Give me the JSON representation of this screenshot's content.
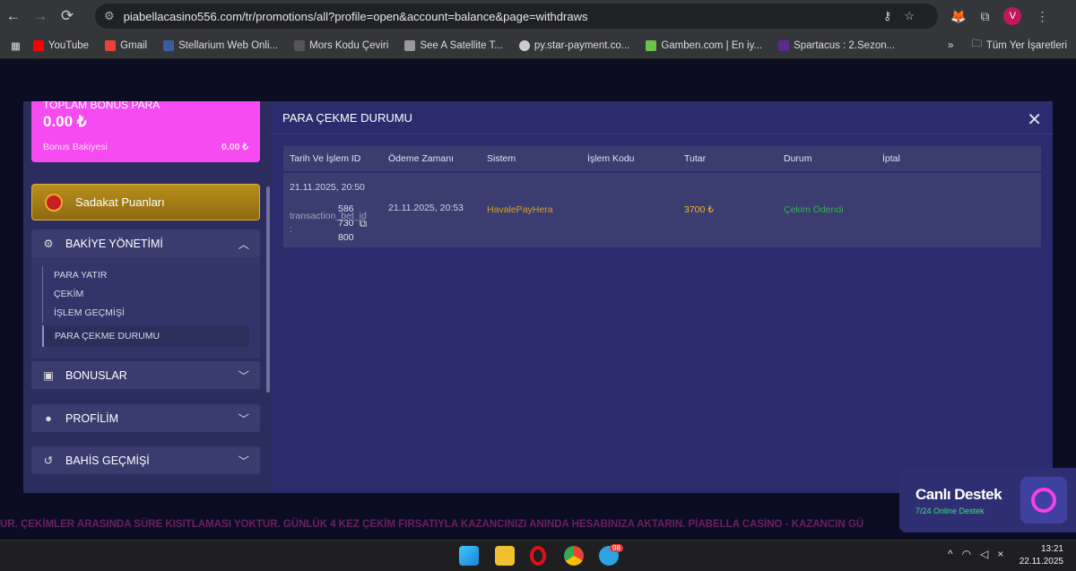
{
  "browser": {
    "url": "piabellacasino556.com/tr/promotions/all?profile=open&account=balance&page=withdraws",
    "profile_initial": "V",
    "bookmarks": [
      {
        "label": "YouTube",
        "color": "#ff0000"
      },
      {
        "label": "Gmail",
        "color": "#ea4335"
      },
      {
        "label": "Stellarium Web Onli...",
        "color": "#3a5fa0"
      },
      {
        "label": "Mors Kodu Çeviri",
        "color": "#555"
      },
      {
        "label": "See A Satellite T...",
        "color": "#999"
      },
      {
        "label": "py.star-payment.co...",
        "color": "#ccc"
      },
      {
        "label": "Gamben.com | En iy...",
        "color": "#6bc24a"
      },
      {
        "label": "Spartacus : 2.Sezon...",
        "color": "#5a2a90"
      }
    ],
    "all_bookmarks": "Tüm Yer İşaretleri"
  },
  "sidebar": {
    "bonus_title": "TOPLAM BONUS PARA",
    "bonus_value": "0.00 ₺",
    "bonus_balance_label": "Bonus Bakiyesi",
    "bonus_balance_value": "0.00 ₺",
    "loyalty": "Sadakat Puanları",
    "balance_mgmt": "BAKİYE YÖNETİMİ",
    "submenu": [
      "PARA YATIR",
      "ÇEKİM",
      "İŞLEM GEÇMİŞİ",
      "PARA ÇEKME DURUMU"
    ],
    "bonuses": "BONUSLAR",
    "profile": "PROFİLİM",
    "bet_history": "BAHİS GEÇMİŞİ"
  },
  "modal": {
    "title": "PARA ÇEKME DURUMU",
    "columns": [
      "Tarih Ve İşlem ID",
      "Ödeme Zamanı",
      "Sistem",
      "İşlem Kodu",
      "Tutar",
      "Durum",
      "İptal"
    ],
    "rows": [
      {
        "date": "21.11.2025, 20:50",
        "id_label": "transaction_bet_id :",
        "id_parts": [
          "586",
          "730",
          "800"
        ],
        "paid_at": "21.11.2025, 20:53",
        "system": "HavalePayHera",
        "code": "",
        "amount": "3700 ₺",
        "status": "Çekim Ödendi",
        "cancel": ""
      }
    ]
  },
  "colors": {
    "system": "#d8a21a",
    "amount": "#f2b01e",
    "status": "#2fb24a",
    "accent": "#f54bf0"
  },
  "support": {
    "title": "Canlı Destek",
    "subtitle": "7/24 Online Destek"
  },
  "marquee": "UR. ÇEKİMLER ARASINDA SÜRE KISITLAMASI YOKTUR. GÜNLÜK 4 KEZ ÇEKİM FIRSATIYLA KAZANCINIZI ANINDA HESABINIZA AKTARIN. PİABELLA CASİNO - KAZANCIN GÜ",
  "taskbar": {
    "time": "13:21",
    "date": "22.11.2025",
    "telegram_badge": "98"
  }
}
